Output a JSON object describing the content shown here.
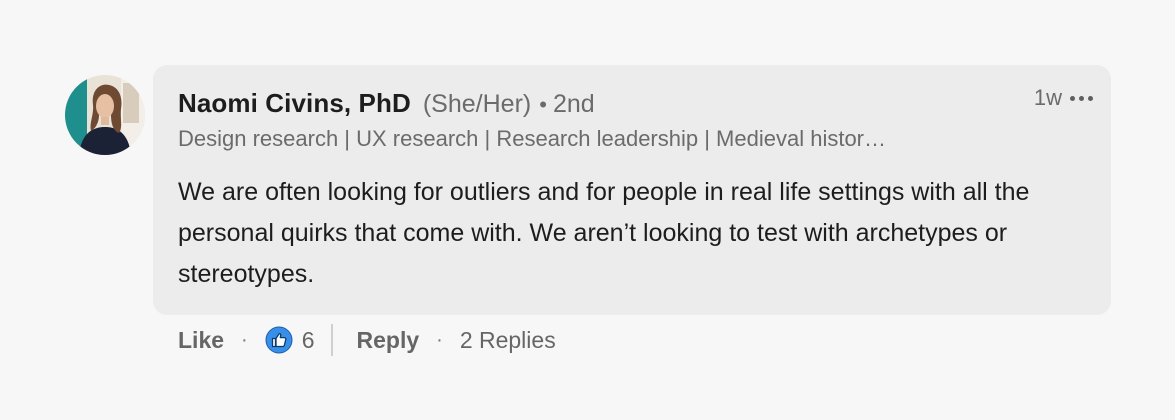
{
  "comment": {
    "author_name": "Naomi Civins, PhD",
    "pronouns": "(She/Her)",
    "separator": "•",
    "connection_degree": "2nd",
    "headline": "Design research | UX research | Research leadership | Medieval histor…",
    "timestamp": "1w",
    "more_icon": "ellipsis-icon",
    "text": "We are often looking for outliers and for people in real life settings with all the personal quirks that come with. We aren’t looking to test with archetypes or stereotypes."
  },
  "actions": {
    "like_label": "Like",
    "dot": "·",
    "reaction_icon": "thumbs-up-icon",
    "reaction_count": "6",
    "reply_label": "Reply",
    "replies_label": "2 Replies"
  },
  "colors": {
    "background": "#f7f7f7",
    "bubble": "#ececec",
    "like_blue": "#378fe9"
  }
}
